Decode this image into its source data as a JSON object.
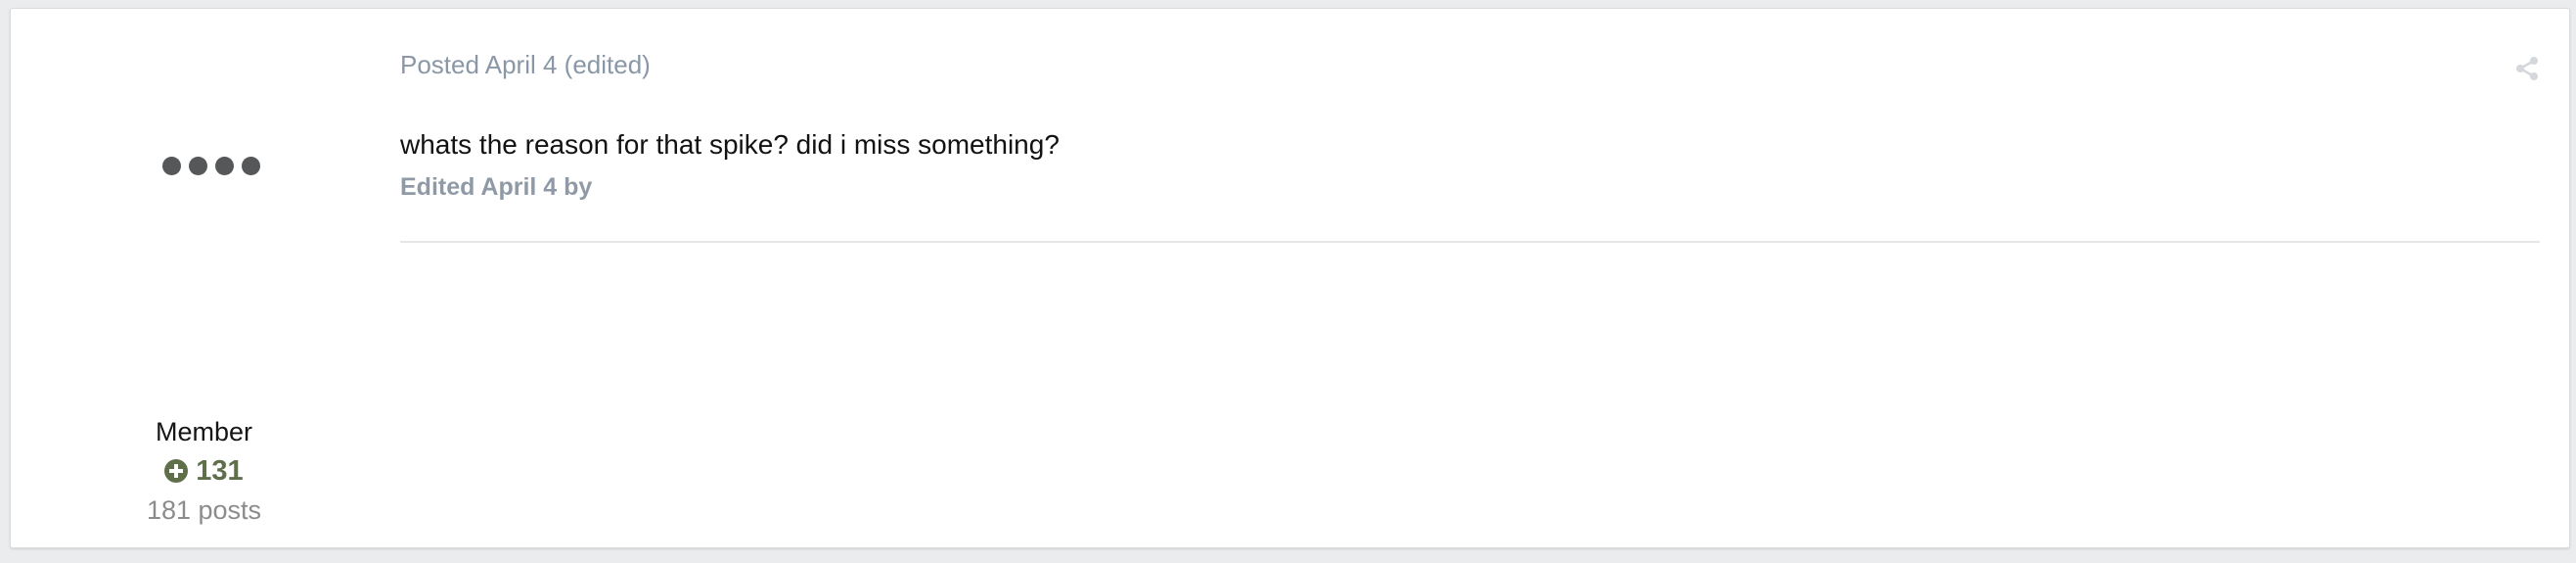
{
  "author": {
    "member_title": "Member",
    "reputation": "131",
    "post_count": "181 posts",
    "avatar_icon": "redacted-avatar-dots-icon",
    "reputation_icon": "plus-circle-icon",
    "reputation_color": "#5e6f49"
  },
  "post": {
    "posted_label": "Posted April 4 (edited)",
    "body_text": "whats the reason for that spike? did i miss something?",
    "edited_note": "Edited April 4 by",
    "share_icon": "share-icon"
  }
}
